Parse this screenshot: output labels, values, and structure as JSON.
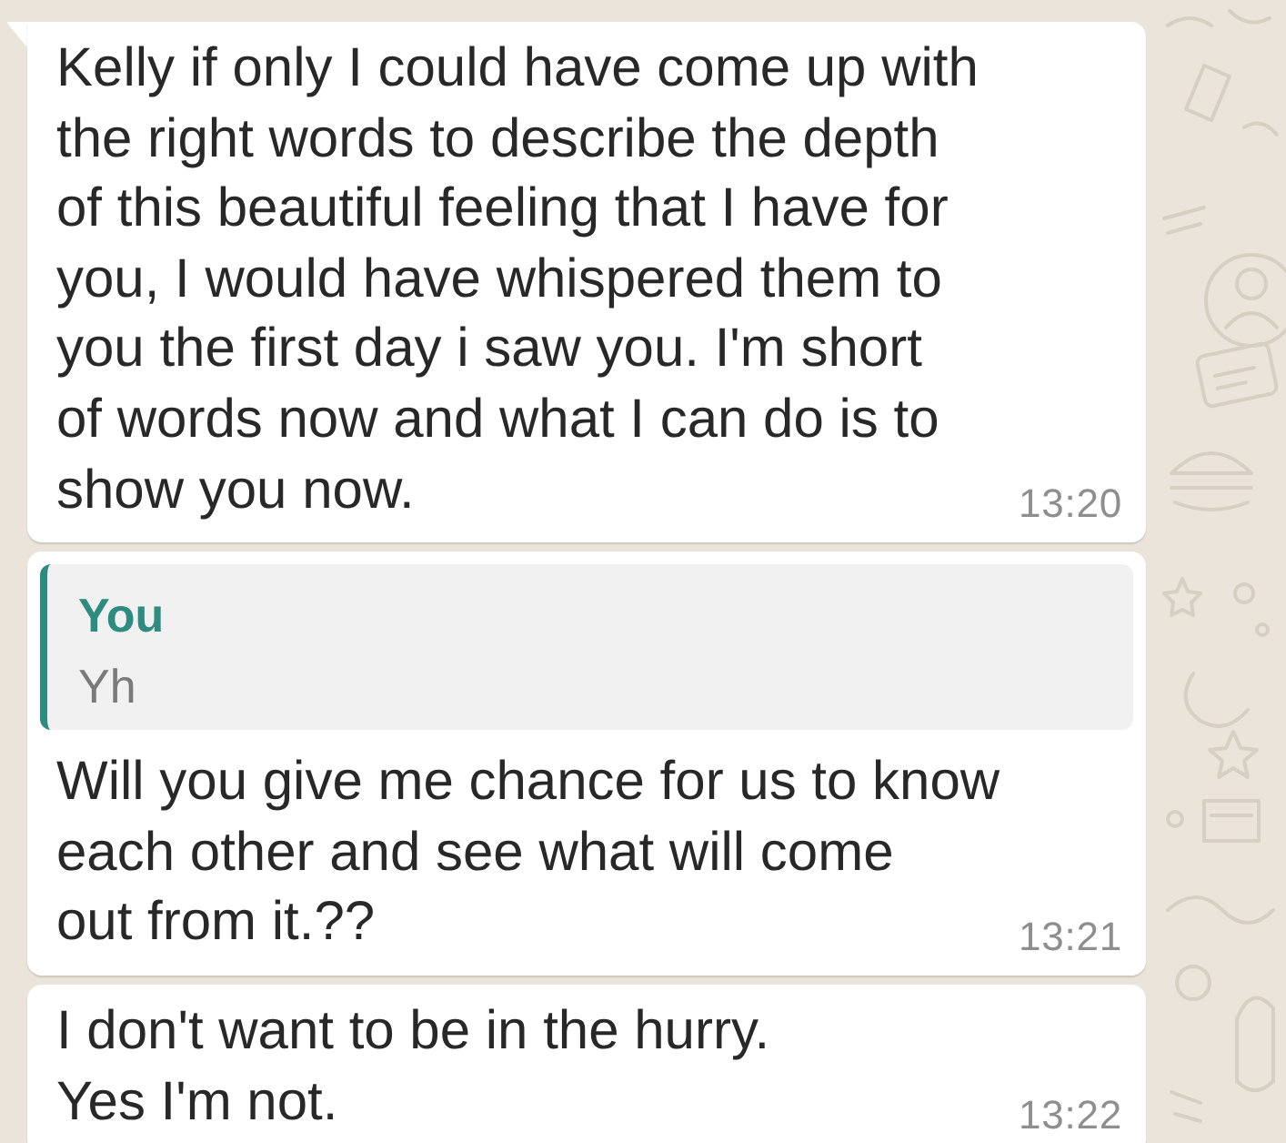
{
  "messages": [
    {
      "kind": "text",
      "tail": true,
      "text": "Kelly if only I could have come up with\nthe right words to describe the depth\nof this beautiful feeling that I have for\nyou, I would have whispered them to\nyou the first day i saw you. I'm short\nof words now and what I can do is to\nshow you now.",
      "time": "13:20"
    },
    {
      "kind": "reply",
      "tail": false,
      "quote": {
        "author": "You",
        "text": "Yh"
      },
      "text": "Will you give me chance for us to know\neach other and see what will come\nout from it.??",
      "time": "13:21"
    },
    {
      "kind": "text",
      "tail": false,
      "text": "I don't want to be in the hurry.\nYes I'm not.",
      "time": "13:22"
    }
  ]
}
